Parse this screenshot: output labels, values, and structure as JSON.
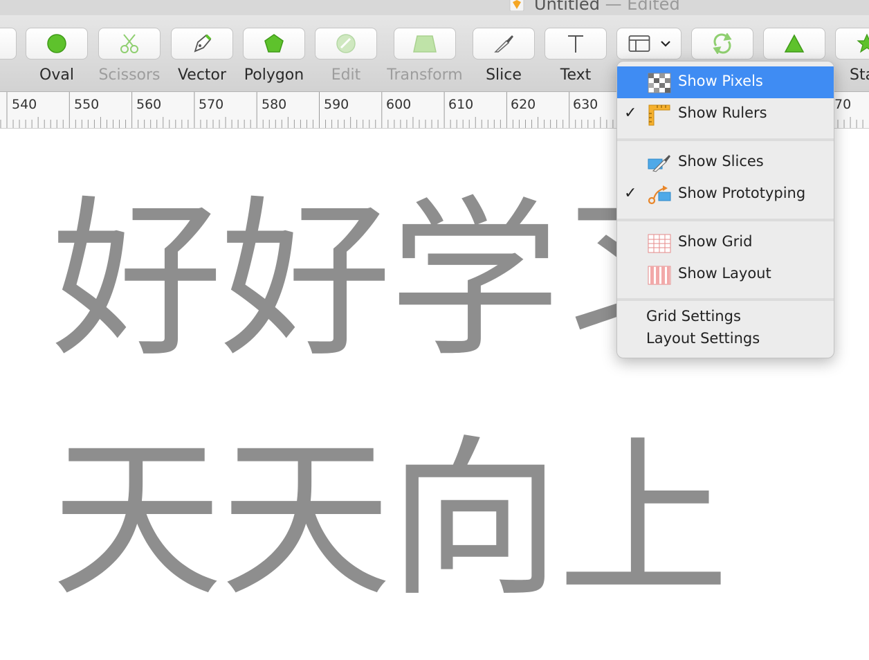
{
  "window": {
    "title": "Untitled",
    "title_suffix": "— Edited"
  },
  "toolbar": {
    "tools": [
      {
        "label": "Oval",
        "icon": "oval-icon",
        "enabled": true
      },
      {
        "label": "Scissors",
        "icon": "scissors-icon",
        "enabled": false
      },
      {
        "label": "Vector",
        "icon": "vector-pen-icon",
        "enabled": true
      },
      {
        "label": "Polygon",
        "icon": "polygon-icon",
        "enabled": true
      },
      {
        "label": "Edit",
        "icon": "edit-icon",
        "enabled": false
      },
      {
        "label": "Transform",
        "icon": "transform-icon",
        "enabled": false
      },
      {
        "label": "Slice",
        "icon": "slice-knife-icon",
        "enabled": true
      },
      {
        "label": "Text",
        "icon": "text-icon",
        "enabled": true
      },
      {
        "label": "",
        "icon": "view-layout-icon",
        "enabled": true
      },
      {
        "label": "",
        "icon": "rotate-icon",
        "enabled": false
      },
      {
        "label": "",
        "icon": "triangle-icon",
        "enabled": true
      },
      {
        "label": "Sta",
        "icon": "star-icon",
        "enabled": true
      }
    ]
  },
  "ruler": {
    "labels": [
      "540",
      "550",
      "560",
      "570",
      "580",
      "590",
      "600",
      "610",
      "620",
      "630",
      "70"
    ]
  },
  "canvas": {
    "line1": "好好学习",
    "line2": "天天向上"
  },
  "view_menu": {
    "items": [
      {
        "label": "Show Pixels",
        "checked": false,
        "highlighted": true,
        "icon": "pixels-icon"
      },
      {
        "label": "Show Rulers",
        "checked": true,
        "highlighted": false,
        "icon": "ruler-icon"
      },
      {
        "label": "Show Slices",
        "checked": false,
        "highlighted": false,
        "icon": "slices-icon"
      },
      {
        "label": "Show Prototyping",
        "checked": true,
        "highlighted": false,
        "icon": "prototyping-icon"
      },
      {
        "label": "Show Grid",
        "checked": false,
        "highlighted": false,
        "icon": "grid-icon"
      },
      {
        "label": "Show Layout",
        "checked": false,
        "highlighted": false,
        "icon": "layout-columns-icon"
      },
      {
        "label": "Grid Settings",
        "checked": false,
        "highlighted": false,
        "icon": ""
      },
      {
        "label": "Layout Settings",
        "checked": false,
        "highlighted": false,
        "icon": ""
      }
    ],
    "checkmark": "✓"
  },
  "colors": {
    "menu_highlight": "#3f8cf3",
    "canvas_text": "#8e8e8e",
    "tool_green": "#5ec22c"
  }
}
